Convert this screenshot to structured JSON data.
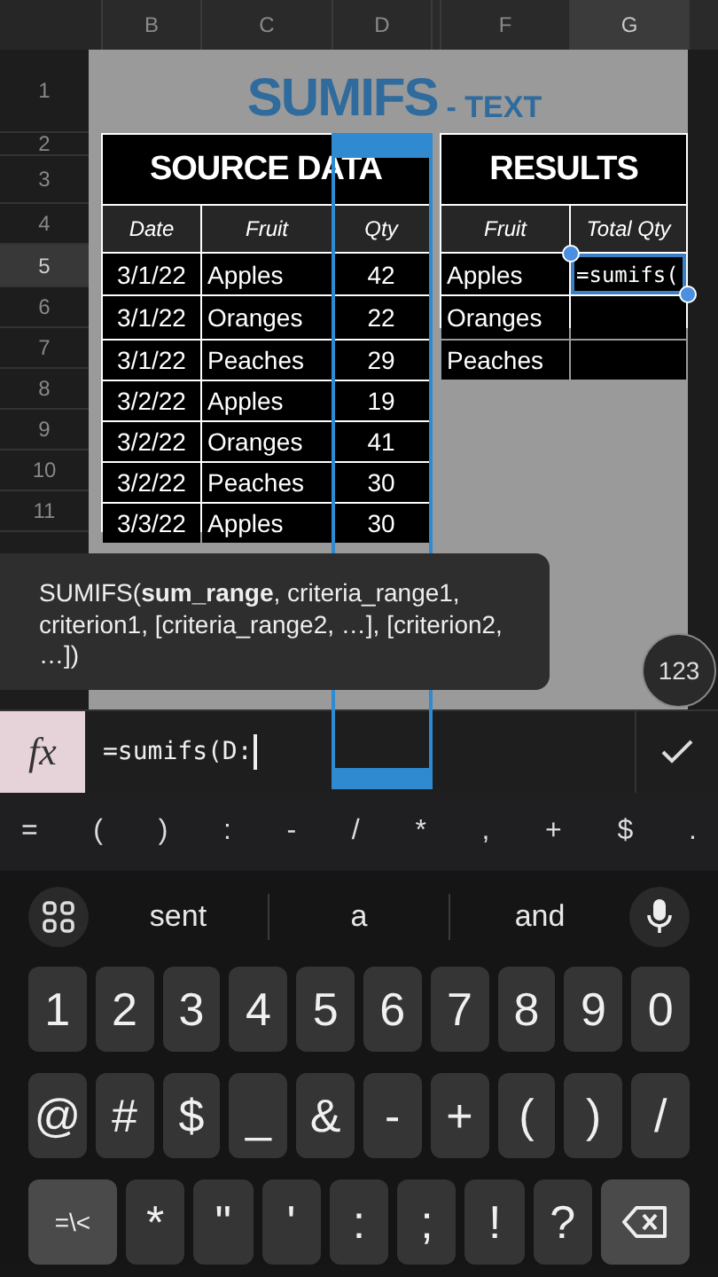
{
  "column_headers": [
    {
      "label": "B",
      "selected": false
    },
    {
      "label": "C",
      "selected": false
    },
    {
      "label": "D",
      "selected": false
    },
    {
      "label": "F",
      "selected": false
    },
    {
      "label": "G",
      "selected": true
    }
  ],
  "row_headers": [
    {
      "label": "1",
      "selected": false
    },
    {
      "label": "2",
      "selected": false
    },
    {
      "label": "3",
      "selected": false
    },
    {
      "label": "4",
      "selected": false
    },
    {
      "label": "5",
      "selected": true
    },
    {
      "label": "6",
      "selected": false
    },
    {
      "label": "7",
      "selected": false
    },
    {
      "label": "8",
      "selected": false
    },
    {
      "label": "9",
      "selected": false
    },
    {
      "label": "10",
      "selected": false
    },
    {
      "label": "11",
      "selected": false
    }
  ],
  "sheet_title": {
    "main": "SUMIFS",
    "suffix": "- TEXT"
  },
  "source_table": {
    "title": "SOURCE DATA",
    "columns": [
      "Date",
      "Fruit",
      "Qty"
    ],
    "rows": [
      [
        "3/1/22",
        "Apples",
        "42"
      ],
      [
        "3/1/22",
        "Oranges",
        "22"
      ],
      [
        "3/1/22",
        "Peaches",
        "29"
      ],
      [
        "3/2/22",
        "Apples",
        "19"
      ],
      [
        "3/2/22",
        "Oranges",
        "41"
      ],
      [
        "3/2/22",
        "Peaches",
        "30"
      ],
      [
        "3/3/22",
        "Apples",
        "30"
      ]
    ]
  },
  "results_table": {
    "title": "RESULTS",
    "columns": [
      "Fruit",
      "Total Qty"
    ],
    "rows": [
      {
        "fruit": "Apples",
        "total": "=sumifs(",
        "selected": true
      },
      {
        "fruit": "Oranges",
        "total": "",
        "selected": false
      },
      {
        "fruit": "Peaches",
        "total": "",
        "selected": false
      }
    ]
  },
  "tooltip": "SUMIFS(**sum_range**, criteria_range1, criterion1, [criteria_range2, …], [criterion2, …])",
  "floating_badge": "123",
  "formula_bar": {
    "icon": "fx",
    "value": "=sumifs(D:"
  },
  "symbol_bar": [
    "=",
    "(",
    ")",
    ":",
    "-",
    "/",
    "*",
    ",",
    "+",
    "$",
    "."
  ],
  "suggestions": [
    "sent",
    "a",
    "and"
  ],
  "keyboard": [
    [
      {
        "label": "1",
        "kind": "char"
      },
      {
        "label": "2",
        "kind": "char"
      },
      {
        "label": "3",
        "kind": "char"
      },
      {
        "label": "4",
        "kind": "char"
      },
      {
        "label": "5",
        "kind": "char"
      },
      {
        "label": "6",
        "kind": "char"
      },
      {
        "label": "7",
        "kind": "char"
      },
      {
        "label": "8",
        "kind": "char"
      },
      {
        "label": "9",
        "kind": "char"
      },
      {
        "label": "0",
        "kind": "char"
      }
    ],
    [
      {
        "label": "@",
        "kind": "char"
      },
      {
        "label": "#",
        "kind": "char"
      },
      {
        "label": "$",
        "kind": "char"
      },
      {
        "label": "_",
        "kind": "char"
      },
      {
        "label": "&",
        "kind": "char"
      },
      {
        "label": "-",
        "kind": "char"
      },
      {
        "label": "+",
        "kind": "char"
      },
      {
        "label": "(",
        "kind": "char"
      },
      {
        "label": ")",
        "kind": "char"
      },
      {
        "label": "/",
        "kind": "char"
      }
    ],
    [
      {
        "label": "=\\<",
        "kind": "mode"
      },
      {
        "label": "*",
        "kind": "char"
      },
      {
        "label": "\"",
        "kind": "char"
      },
      {
        "label": "'",
        "kind": "char"
      },
      {
        "label": ":",
        "kind": "char"
      },
      {
        "label": ";",
        "kind": "char"
      },
      {
        "label": "!",
        "kind": "char"
      },
      {
        "label": "?",
        "kind": "char"
      },
      {
        "kind": "backspace"
      }
    ]
  ]
}
